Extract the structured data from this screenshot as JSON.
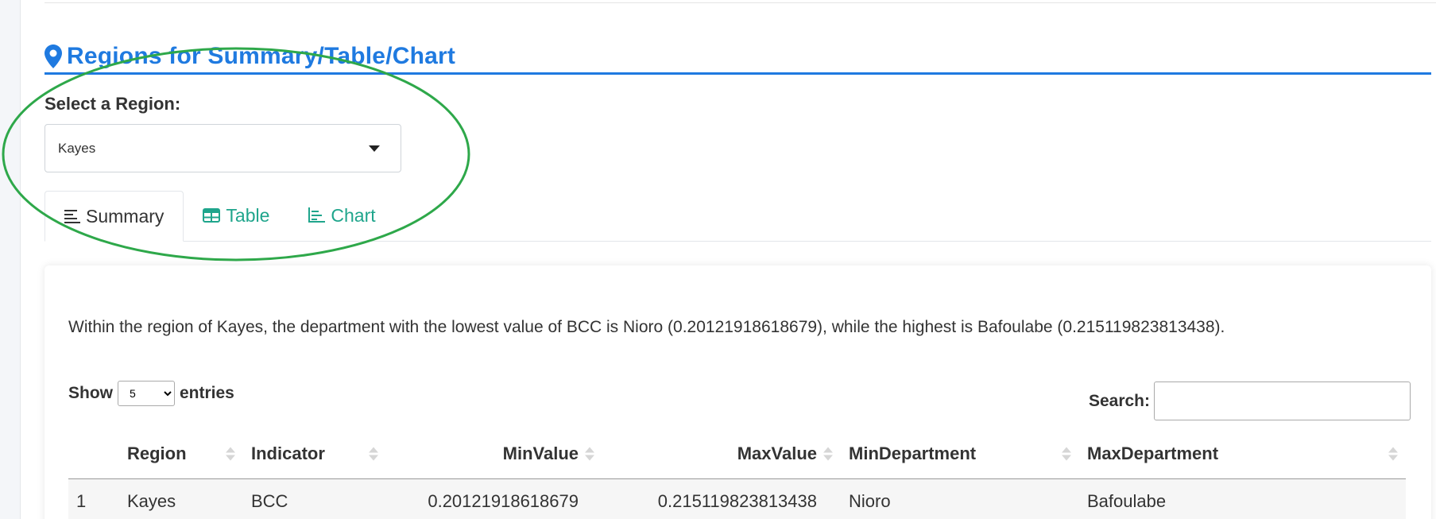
{
  "section": {
    "title": "Regions for Summary/Table/Chart"
  },
  "region_select": {
    "label": "Select a Region:",
    "value": "Kayes"
  },
  "tabs": [
    {
      "label": "Summary",
      "icon": "align-left-icon",
      "active": true
    },
    {
      "label": "Table",
      "icon": "table-icon",
      "active": false
    },
    {
      "label": "Chart",
      "icon": "chart-bar-icon",
      "active": false
    }
  ],
  "summary": {
    "text": "Within the region of Kayes, the department with the lowest value of BCC is Nioro (0.20121918618679), while the highest is Bafoulabe (0.215119823813438)."
  },
  "datatable": {
    "show_label": "Show",
    "entries_label": "entries",
    "page_length": "5",
    "search_label": "Search:",
    "search_value": "",
    "columns": [
      "",
      "Region",
      "Indicator",
      "MinValue",
      "MaxValue",
      "MinDepartment",
      "MaxDepartment"
    ],
    "rows": [
      [
        "1",
        "Kayes",
        "BCC",
        "0.20121918618679",
        "0.215119823813438",
        "Nioro",
        "Bafoulabe"
      ]
    ]
  },
  "colors": {
    "accent_blue": "#1f7ae0",
    "tab_green": "#1fa58c",
    "annotation_green": "#2ea84a"
  }
}
